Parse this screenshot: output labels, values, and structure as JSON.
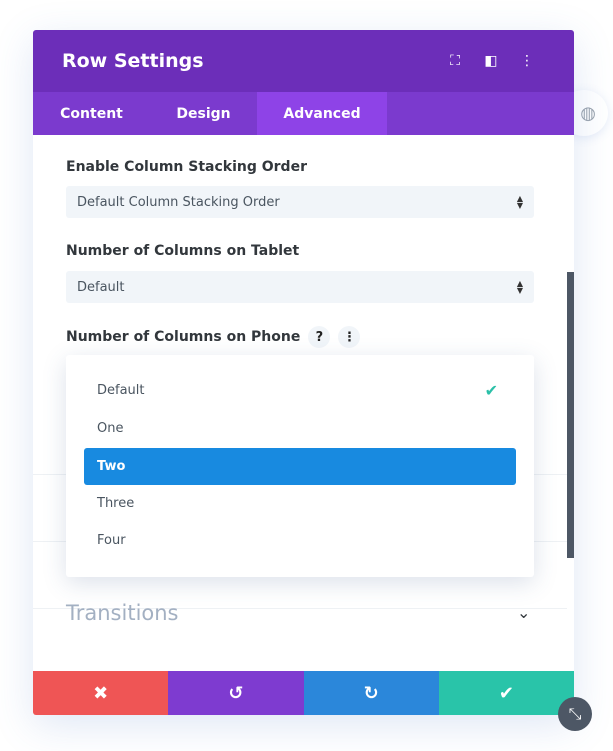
{
  "header": {
    "title": "Row Settings",
    "icons": [
      "fullscreen-icon",
      "sidebar-layout-icon",
      "more-vertical-icon"
    ]
  },
  "tabs": [
    {
      "label": "Content"
    },
    {
      "label": "Design"
    },
    {
      "label": "Advanced",
      "active": true
    }
  ],
  "fields": [
    {
      "label": "Enable Column Stacking Order",
      "value": "Default Column Stacking Order"
    },
    {
      "label": "Number of Columns on Tablet",
      "value": "Default"
    },
    {
      "label": "Number of Columns on Phone",
      "help": "?",
      "menu": "⋮"
    }
  ],
  "dropdown": {
    "options": [
      "Default",
      "One",
      "Two",
      "Three",
      "Four"
    ],
    "checked": "Default",
    "highlighted": "Two"
  },
  "section": {
    "title": "Transitions"
  },
  "colors": {
    "header": "#6c2eb9",
    "tabs": "#7b3ace",
    "active_tab": "#8e43e7",
    "cancel": "#ef5555",
    "undo": "#7e3bd0",
    "redo": "#2b87da",
    "save": "#29c4a9",
    "highlight": "#188ae0"
  }
}
